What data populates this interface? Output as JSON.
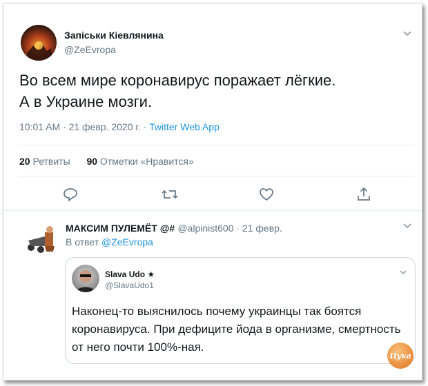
{
  "tweet": {
    "author_name": "Запіськи Кіевлянина",
    "author_handle": "@ZeEvropa",
    "text_line1": "Во всем мире коронавирус поражает лёгкие.",
    "text_line2": "А в Украине мозги.",
    "timestamp": "10:01 AM · 21 февр. 2020 г. · ",
    "source": "Twitter Web App",
    "retweets_count": "20",
    "retweets_label": "Ретвиты",
    "likes_count": "90",
    "likes_label": "Отметки «Нравится»"
  },
  "reply": {
    "author_name": "МАКСИМ ПУЛЕМЁТ @#",
    "author_handle": "@alpinist600 · 21 февр.",
    "reply_prefix": "В ответ ",
    "reply_to": "@ZeEvropa",
    "quote": {
      "author_name": "Slava Udo ★",
      "author_handle": "@SlavaUdo1",
      "text": "Наконец-то выяснилось почему украинцы так боятся коронавируса. При дефиците йода в организме, смертность от него почти 100%-ная."
    }
  },
  "icons": [
    "chevron-down-icon",
    "reply-icon",
    "retweet-icon",
    "like-icon",
    "share-icon"
  ],
  "colors": {
    "link": "#1b95e0",
    "muted": "#657786",
    "text": "#14171a",
    "border": "#e6ecf0"
  }
}
